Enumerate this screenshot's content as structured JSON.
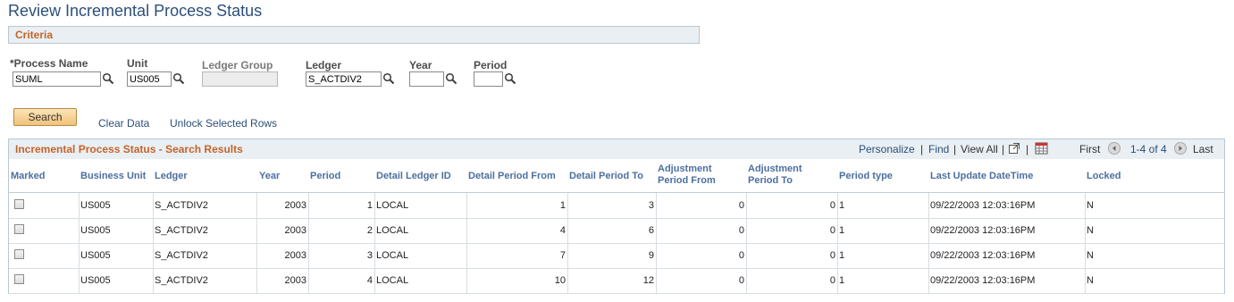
{
  "page": {
    "title": "Review Incremental Process Status"
  },
  "criteria": {
    "section_title": "Criteria",
    "process_name": {
      "label": "*Process Name",
      "value": "SUML"
    },
    "unit": {
      "label": "Unit",
      "value": "US005"
    },
    "ledger_group": {
      "label": "Ledger Group",
      "value": ""
    },
    "ledger": {
      "label": "Ledger",
      "value": "S_ACTDIV2"
    },
    "year": {
      "label": "Year",
      "value": ""
    },
    "period": {
      "label": "Period",
      "value": ""
    }
  },
  "actions": {
    "search": "Search",
    "clear_data": "Clear Data",
    "unlock_rows": "Unlock Selected Rows"
  },
  "results": {
    "title": "Incremental Process Status - Search Results",
    "personalize": "Personalize",
    "find": "Find",
    "view_all": "View All",
    "first": "First",
    "range": "1-4 of 4",
    "last": "Last",
    "columns": {
      "marked": "Marked",
      "business_unit": "Business Unit",
      "ledger": "Ledger",
      "year": "Year",
      "period": "Period",
      "detail_ledger_id": "Detail Ledger ID",
      "detail_period_from": "Detail Period From",
      "detail_period_to": "Detail Period To",
      "adj_period_from_1": "Adjustment",
      "adj_period_from_2": "Period From",
      "adj_period_to_1": "Adjustment",
      "adj_period_to_2": "Period To",
      "period_type": "Period type",
      "last_update": "Last Update DateTime",
      "locked": "Locked"
    },
    "rows": [
      {
        "bu": "US005",
        "ledger": "S_ACTDIV2",
        "year": "2003",
        "period": "1",
        "detail_ledger": "LOCAL",
        "dp_from": "1",
        "dp_to": "3",
        "adj_from": "0",
        "adj_to": "0",
        "ptype": "1",
        "updated": "09/22/2003 12:03:16PM",
        "locked": "N"
      },
      {
        "bu": "US005",
        "ledger": "S_ACTDIV2",
        "year": "2003",
        "period": "2",
        "detail_ledger": "LOCAL",
        "dp_from": "4",
        "dp_to": "6",
        "adj_from": "0",
        "adj_to": "0",
        "ptype": "1",
        "updated": "09/22/2003 12:03:16PM",
        "locked": "N"
      },
      {
        "bu": "US005",
        "ledger": "S_ACTDIV2",
        "year": "2003",
        "period": "3",
        "detail_ledger": "LOCAL",
        "dp_from": "7",
        "dp_to": "9",
        "adj_from": "0",
        "adj_to": "0",
        "ptype": "1",
        "updated": "09/22/2003 12:03:16PM",
        "locked": "N"
      },
      {
        "bu": "US005",
        "ledger": "S_ACTDIV2",
        "year": "2003",
        "period": "4",
        "detail_ledger": "LOCAL",
        "dp_from": "10",
        "dp_to": "12",
        "adj_from": "0",
        "adj_to": "0",
        "ptype": "1",
        "updated": "09/22/2003 12:03:16PM",
        "locked": "N"
      }
    ]
  }
}
